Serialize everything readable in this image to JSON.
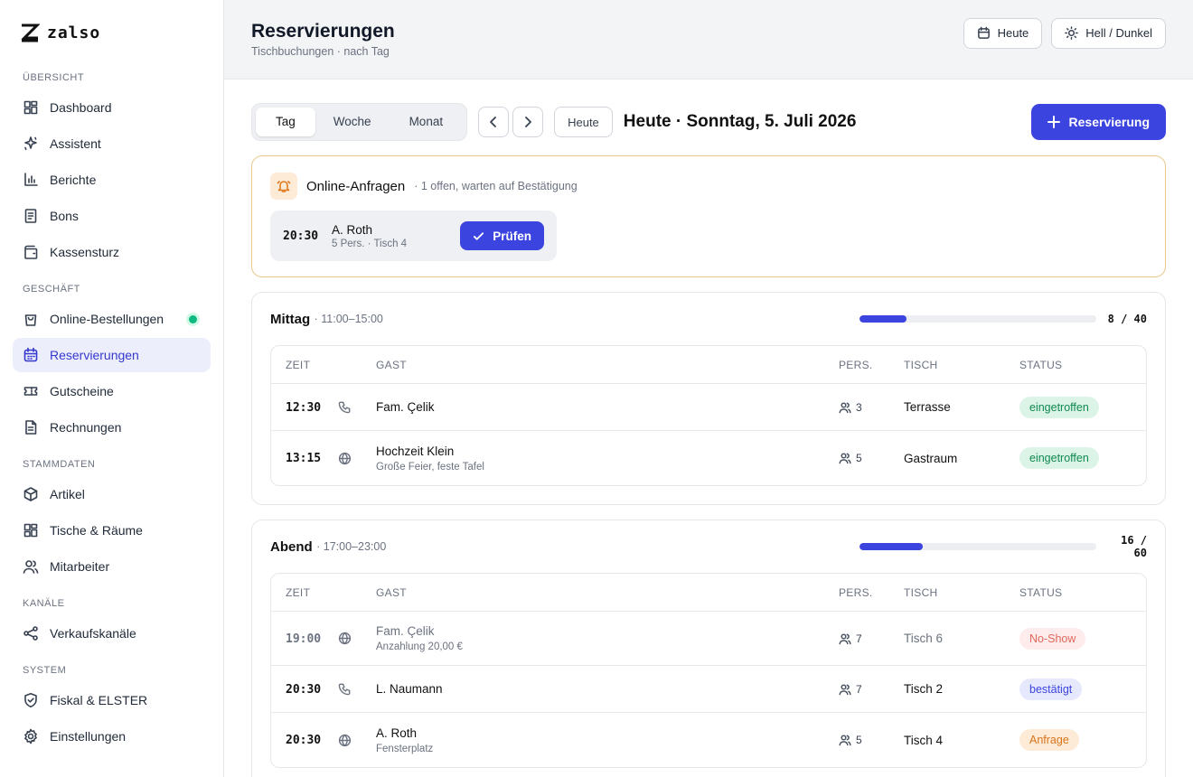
{
  "brand": {
    "name": "zalso"
  },
  "sidebar": {
    "sections": [
      {
        "label": "ÜBERSICHT",
        "items": [
          {
            "label": "Dashboard",
            "icon": "grid-icon"
          },
          {
            "label": "Assistent",
            "icon": "sparkle-icon"
          },
          {
            "label": "Berichte",
            "icon": "chart-icon"
          },
          {
            "label": "Bons",
            "icon": "receipt-icon"
          },
          {
            "label": "Kassensturz",
            "icon": "wallet-icon"
          }
        ]
      },
      {
        "label": "GESCHÄFT",
        "items": [
          {
            "label": "Online-Bestellungen",
            "icon": "bag-icon",
            "status_dot": "#10b981"
          },
          {
            "label": "Reservierungen",
            "icon": "calendar-icon",
            "active": true
          },
          {
            "label": "Gutscheine",
            "icon": "ticket-icon"
          },
          {
            "label": "Rechnungen",
            "icon": "document-icon"
          }
        ]
      },
      {
        "label": "STAMMDATEN",
        "items": [
          {
            "label": "Artikel",
            "icon": "box-icon"
          },
          {
            "label": "Tische & Räume",
            "icon": "grid-icon"
          },
          {
            "label": "Mitarbeiter",
            "icon": "users-icon"
          }
        ]
      },
      {
        "label": "KANÄLE",
        "items": [
          {
            "label": "Verkaufskanäle",
            "icon": "share-icon"
          }
        ]
      },
      {
        "label": "SYSTEM",
        "items": [
          {
            "label": "Fiskal & ELSTER",
            "icon": "shield-icon"
          },
          {
            "label": "Einstellungen",
            "icon": "gear-icon"
          }
        ]
      }
    ]
  },
  "header": {
    "title": "Reservierungen",
    "subtitle": "Tischbuchungen · nach Tag",
    "today_button": "Heute",
    "theme_button": "Hell / Dunkel"
  },
  "toolbar": {
    "views": [
      "Tag",
      "Woche",
      "Monat"
    ],
    "active_view": "Tag",
    "today_label": "Heute",
    "date_label": "Heute · Sonntag, 5. Juli 2026",
    "new_button": "Reservierung"
  },
  "requests": {
    "title": "Online-Anfragen",
    "subtitle": "· 1 offen, warten auf Bestätigung",
    "items": [
      {
        "time": "20:30",
        "name": "A. Roth",
        "meta": "5 Pers. · Tisch 4",
        "action": "Prüfen"
      }
    ]
  },
  "columns": {
    "time": "ZEIT",
    "guest": "GAST",
    "persons": "PERS.",
    "table": "TISCH",
    "status": "STATUS"
  },
  "services": [
    {
      "name": "Mittag",
      "range": "· 11:00–15:00",
      "booked": 8,
      "capacity": 40,
      "count_label": "8 / 40",
      "rows": [
        {
          "time": "12:30",
          "channel": "phone-icon",
          "guest": "Fam. Çelik",
          "note": "",
          "persons": "3",
          "table": "Terrasse",
          "status": "eingetroffen",
          "status_kind": "green"
        },
        {
          "time": "13:15",
          "channel": "globe-icon",
          "guest": "Hochzeit Klein",
          "note": "Große Feier, feste Tafel",
          "persons": "5",
          "table": "Gastraum",
          "status": "eingetroffen",
          "status_kind": "green"
        }
      ]
    },
    {
      "name": "Abend",
      "range": "· 17:00–23:00",
      "booked": 16,
      "capacity": 60,
      "count_label": "16 / 60",
      "rows": [
        {
          "time": "19:00",
          "channel": "globe-icon",
          "guest": "Fam. Çelik",
          "note": "Anzahlung 20,00 €",
          "persons": "7",
          "table": "Tisch 6",
          "status": "No-Show",
          "status_kind": "red",
          "muted": true
        },
        {
          "time": "20:30",
          "channel": "phone-icon",
          "guest": "L. Naumann",
          "note": "",
          "persons": "7",
          "table": "Tisch 2",
          "status": "bestätigt",
          "status_kind": "blue"
        },
        {
          "time": "20:30",
          "channel": "globe-icon",
          "guest": "A. Roth",
          "note": "Fensterplatz",
          "persons": "5",
          "table": "Tisch 4",
          "status": "Anfrage",
          "status_kind": "orange"
        }
      ]
    }
  ]
}
